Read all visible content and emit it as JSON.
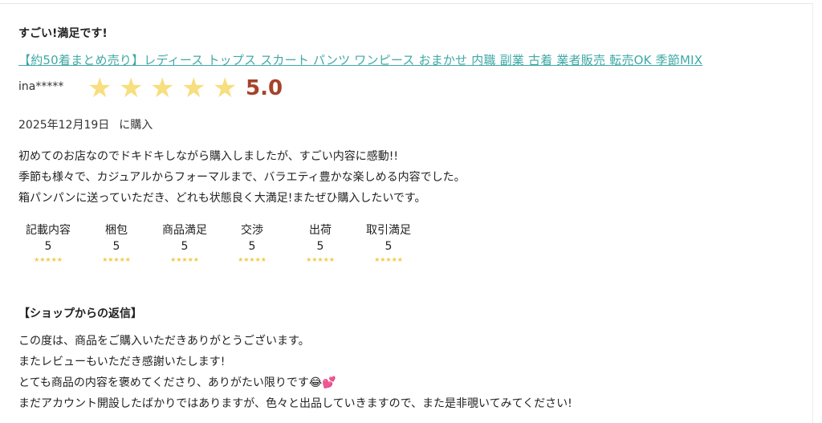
{
  "review": {
    "title": "すごい!満足です!",
    "product_link": "【約50着まとめ売り】レディース トップス スカート パンツ ワンピース おまかせ 内職 副業 古着 業者販売 転売OK 季節MIX",
    "user_name": "ina*****",
    "star_rating": 5,
    "score": "5.0",
    "purchase_date": "2025年12月19日",
    "purchase_suffix": "に購入",
    "body_lines": [
      "初めてのお店なのでドキドキしながら購入しましたが、すごい内容に感動!!",
      "季節も様々で、カジュアルからフォーマルまで、バラエティ豊かな楽しめる内容でした。",
      "箱パンパンに送っていただき、どれも状態良く大満足!またぜひ購入したいです。"
    ]
  },
  "ratings": [
    {
      "label": "記載内容",
      "value": "5"
    },
    {
      "label": "梱包",
      "value": "5"
    },
    {
      "label": "商品満足",
      "value": "5"
    },
    {
      "label": "交渉",
      "value": "5"
    },
    {
      "label": "出荷",
      "value": "5"
    },
    {
      "label": "取引満足",
      "value": "5"
    }
  ],
  "reply": {
    "title": "【ショップからの返信】",
    "lines": [
      "この度は、商品をご購入いただきありがとうございます。",
      "またレビューもいただき感謝いたします!",
      "とても商品の内容を褒めてくださり、ありがたい限りです😂💕",
      "まだアカウント開設したばかりではありますが、色々と出品していきますので、また是非覗いてみてください!"
    ]
  },
  "colors": {
    "link": "#3fa9a6",
    "star": "#f7de7e",
    "score": "#a5432a"
  },
  "icons": {
    "big_star": "star-icon",
    "small_star": "small-star-icon"
  }
}
